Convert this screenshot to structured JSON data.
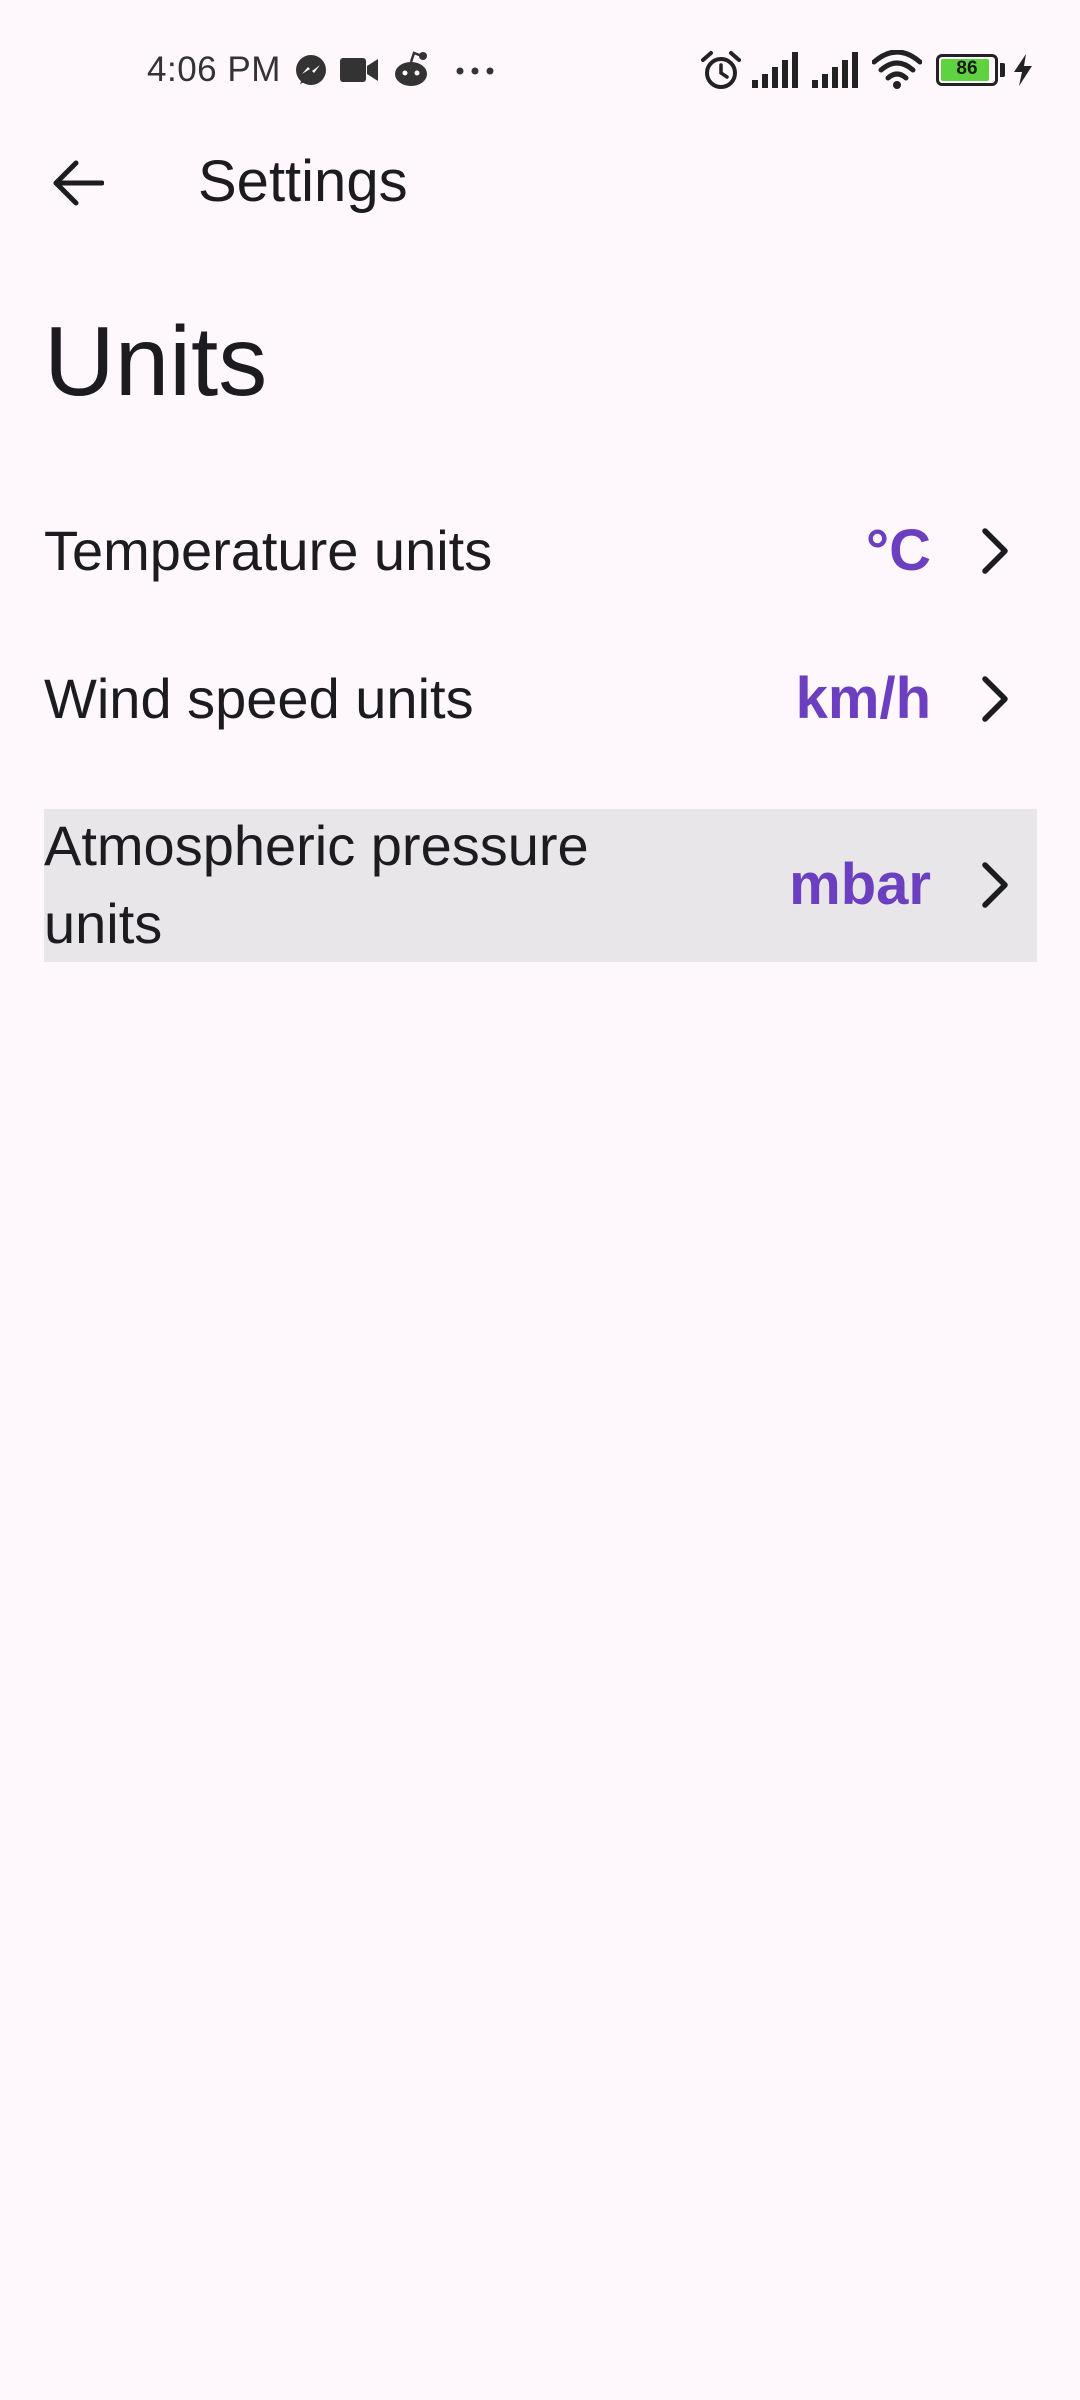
{
  "status_bar": {
    "time": "4:06 PM",
    "icons_left": [
      "messenger-icon",
      "video-camera-icon",
      "reddit-icon",
      "more-dots-icon"
    ],
    "icons_right": [
      "alarm-icon",
      "signal-icon",
      "signal-icon",
      "wifi-icon",
      "battery-icon",
      "charging-bolt-icon"
    ],
    "battery_level": "86"
  },
  "app_bar": {
    "title": "Settings"
  },
  "page": {
    "title": "Units"
  },
  "settings": [
    {
      "label": "Temperature units",
      "value": "°C"
    },
    {
      "label": "Wind speed units",
      "value": "km/h"
    },
    {
      "label_line1": "Atmospheric pressure",
      "label_line2": "units",
      "value": "mbar"
    }
  ],
  "colors": {
    "background": "#fef7fb",
    "accent": "#6b3fbf",
    "highlight": "#e8e6e9",
    "text": "#1c1b1f"
  }
}
